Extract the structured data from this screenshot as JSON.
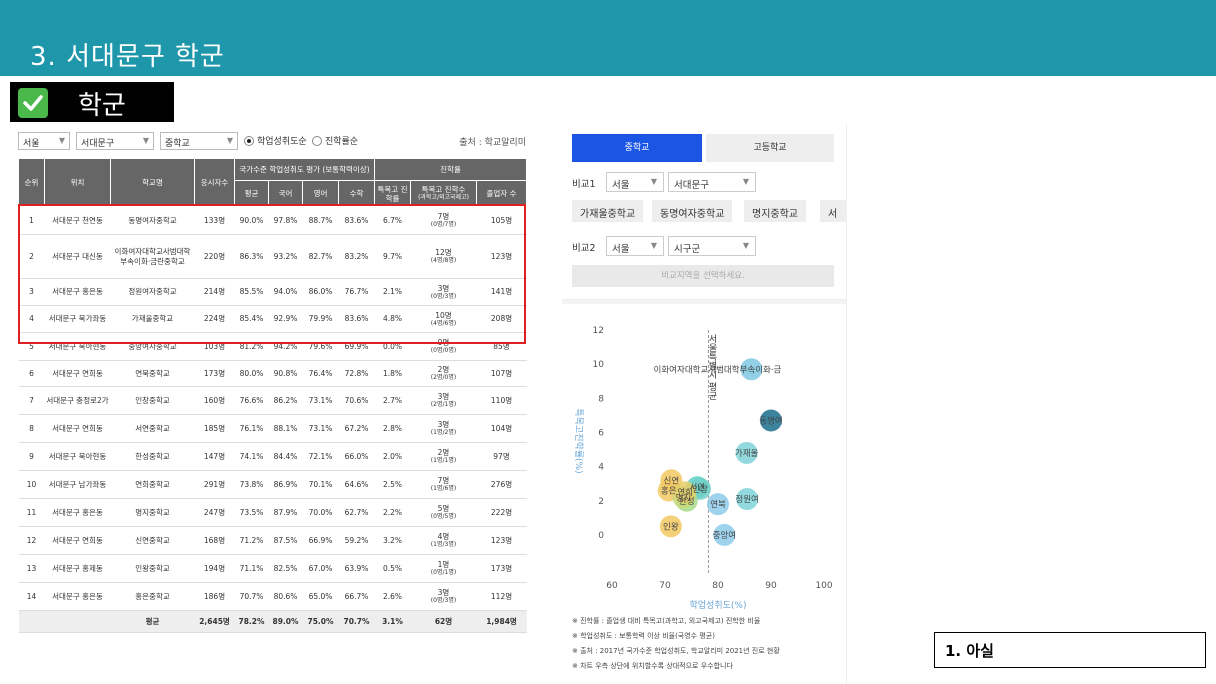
{
  "banner": {
    "title": "3. 서대문구 학군"
  },
  "section": {
    "label": "학군"
  },
  "filters": {
    "city": "서울",
    "district": "서대문구",
    "level": "중학교",
    "radio1": "학업성취도순",
    "radio2": "진학률순",
    "source": "출처 : 학교알리미"
  },
  "table": {
    "headers": {
      "rank": "순위",
      "location": "위치",
      "school": "학교명",
      "applicants": "응시자수",
      "achievement_group": "국가수준 학업성취도 평가 (보통학력이상)",
      "avg": "평균",
      "korean": "국어",
      "english": "영어",
      "math": "수학",
      "advance_group": "진학률",
      "special_rate": "특목고 진학률",
      "special_count": "특목고 진학수",
      "special_count_sub": "(과학고/외고국제고)",
      "graduates": "졸업자 수"
    },
    "rows": [
      {
        "rank": "1",
        "loc": "서대문구 천연동",
        "name": "동명여자중학교",
        "n": "133명",
        "avg": "90.0%",
        "kor": "97.8%",
        "eng": "88.7%",
        "math": "83.6%",
        "rate": "6.7%",
        "cnt": "7명",
        "cnt_sub": "(0명/7명)",
        "grad": "105명"
      },
      {
        "rank": "2",
        "loc": "서대문구 대신동",
        "name": "이화여자대학교사범대학부속이화·금란중학교",
        "n": "220명",
        "avg": "86.3%",
        "kor": "93.2%",
        "eng": "82.7%",
        "math": "83.2%",
        "rate": "9.7%",
        "cnt": "12명",
        "cnt_sub": "(4명/8명)",
        "grad": "123명"
      },
      {
        "rank": "3",
        "loc": "서대문구 홍은동",
        "name": "정원여자중학교",
        "n": "214명",
        "avg": "85.5%",
        "kor": "94.0%",
        "eng": "86.0%",
        "math": "76.7%",
        "rate": "2.1%",
        "cnt": "3명",
        "cnt_sub": "(0명/3명)",
        "grad": "141명"
      },
      {
        "rank": "4",
        "loc": "서대문구 북가좌동",
        "name": "가재울중학교",
        "n": "224명",
        "avg": "85.4%",
        "kor": "92.9%",
        "eng": "79.9%",
        "math": "83.6%",
        "rate": "4.8%",
        "cnt": "10명",
        "cnt_sub": "(4명/6명)",
        "grad": "208명"
      },
      {
        "rank": "5",
        "loc": "서대문구 북아현동",
        "name": "중앙여자중학교",
        "n": "103명",
        "avg": "81.2%",
        "kor": "94.2%",
        "eng": "79.6%",
        "math": "69.9%",
        "rate": "0.0%",
        "cnt": "0명",
        "cnt_sub": "(0명/0명)",
        "grad": "85명"
      },
      {
        "rank": "6",
        "loc": "서대문구 연희동",
        "name": "연북중학교",
        "n": "173명",
        "avg": "80.0%",
        "kor": "90.8%",
        "eng": "76.4%",
        "math": "72.8%",
        "rate": "1.8%",
        "cnt": "2명",
        "cnt_sub": "(2명/0명)",
        "grad": "107명"
      },
      {
        "rank": "7",
        "loc": "서대문구 충정로2가",
        "name": "인창중학교",
        "n": "160명",
        "avg": "76.6%",
        "kor": "86.2%",
        "eng": "73.1%",
        "math": "70.6%",
        "rate": "2.7%",
        "cnt": "3명",
        "cnt_sub": "(2명/1명)",
        "grad": "110명"
      },
      {
        "rank": "8",
        "loc": "서대문구 연희동",
        "name": "서연중학교",
        "n": "185명",
        "avg": "76.1%",
        "kor": "88.1%",
        "eng": "73.1%",
        "math": "67.2%",
        "rate": "2.8%",
        "cnt": "3명",
        "cnt_sub": "(1명/2명)",
        "grad": "104명"
      },
      {
        "rank": "9",
        "loc": "서대문구 북아현동",
        "name": "한성중학교",
        "n": "147명",
        "avg": "74.1%",
        "kor": "84.4%",
        "eng": "72.1%",
        "math": "66.0%",
        "rate": "2.0%",
        "cnt": "2명",
        "cnt_sub": "(1명/1명)",
        "grad": "97명"
      },
      {
        "rank": "10",
        "loc": "서대문구 남가좌동",
        "name": "연희중학교",
        "n": "291명",
        "avg": "73.8%",
        "kor": "86.9%",
        "eng": "70.1%",
        "math": "64.6%",
        "rate": "2.5%",
        "cnt": "7명",
        "cnt_sub": "(1명/6명)",
        "grad": "276명"
      },
      {
        "rank": "11",
        "loc": "서대문구 홍은동",
        "name": "명지중학교",
        "n": "247명",
        "avg": "73.5%",
        "kor": "87.9%",
        "eng": "70.0%",
        "math": "62.7%",
        "rate": "2.2%",
        "cnt": "5명",
        "cnt_sub": "(0명/5명)",
        "grad": "222명"
      },
      {
        "rank": "12",
        "loc": "서대문구 연희동",
        "name": "신연중학교",
        "n": "168명",
        "avg": "71.2%",
        "kor": "87.5%",
        "eng": "66.9%",
        "math": "59.2%",
        "rate": "3.2%",
        "cnt": "4명",
        "cnt_sub": "(1명/3명)",
        "grad": "123명"
      },
      {
        "rank": "13",
        "loc": "서대문구 홍제동",
        "name": "인왕중학교",
        "n": "194명",
        "avg": "71.1%",
        "kor": "82.5%",
        "eng": "67.0%",
        "math": "63.9%",
        "rate": "0.5%",
        "cnt": "1명",
        "cnt_sub": "(0명/1명)",
        "grad": "173명"
      },
      {
        "rank": "14",
        "loc": "서대문구 홍은동",
        "name": "홍은중학교",
        "n": "186명",
        "avg": "70.7%",
        "kor": "80.6%",
        "eng": "65.0%",
        "math": "66.7%",
        "rate": "2.6%",
        "cnt": "3명",
        "cnt_sub": "(0명/3명)",
        "grad": "112명"
      }
    ],
    "footer": {
      "label": "평균",
      "n": "2,645명",
      "avg": "78.2%",
      "kor": "89.0%",
      "eng": "75.0%",
      "math": "70.7%",
      "rate": "3.1%",
      "cnt": "62명",
      "grad": "1,984명"
    }
  },
  "right": {
    "tab_middle": "중학교",
    "tab_high": "고등학교",
    "compare1_label": "비교1",
    "compare1_city": "서울",
    "compare1_district": "서대문구",
    "chips": [
      "가재울중학교",
      "동명여자중학교",
      "명지중학교",
      "서"
    ],
    "compare2_label": "비교2",
    "compare2_city": "서울",
    "compare2_district": "시구군",
    "prompt": "비교지역을 선택하세요."
  },
  "chart_data": {
    "type": "scatter",
    "xlabel": "학업성취도(%)",
    "ylabel": "특목고진학률(%)",
    "xlim": [
      60,
      100
    ],
    "ylim": [
      -1,
      12
    ],
    "xticks": [
      "60",
      "70",
      "80",
      "90",
      "100"
    ],
    "yticks": [
      "0",
      "2",
      "4",
      "6",
      "8",
      "10",
      "12"
    ],
    "reference_x": 78.2,
    "reference_label": "서울특별시 평균",
    "points": [
      {
        "label": "이화여자대학교사범대학부속이화·금",
        "x": 86.3,
        "y": 9.7,
        "color": "#7ec8e3"
      },
      {
        "label": "동명여",
        "x": 90.0,
        "y": 6.7,
        "color": "#1a6f8c"
      },
      {
        "label": "가재울",
        "x": 85.4,
        "y": 4.8,
        "color": "#7fd3d8"
      },
      {
        "label": "정원여",
        "x": 85.5,
        "y": 2.1,
        "color": "#7fd3d8"
      },
      {
        "label": "중앙여",
        "x": 81.2,
        "y": 0.0,
        "color": "#8ecbea"
      },
      {
        "label": "연북",
        "x": 80.0,
        "y": 1.8,
        "color": "#8ecbea"
      },
      {
        "label": "신연",
        "x": 71.2,
        "y": 3.2,
        "color": "#f2c862"
      },
      {
        "label": "서연",
        "x": 76.1,
        "y": 2.8,
        "color": "#5fcfc5"
      },
      {
        "label": "인창",
        "x": 76.6,
        "y": 2.7,
        "color": "#6fd0c8"
      },
      {
        "label": "한성",
        "x": 74.1,
        "y": 2.0,
        "color": "#a6d98a"
      },
      {
        "label": "홍은",
        "x": 70.7,
        "y": 2.6,
        "color": "#f2c862"
      },
      {
        "label": "명지",
        "x": 73.5,
        "y": 2.2,
        "color": "#c9d97a"
      },
      {
        "label": "연희",
        "x": 73.8,
        "y": 2.5,
        "color": "#e6cf6a"
      },
      {
        "label": "인왕",
        "x": 71.1,
        "y": 0.5,
        "color": "#f2c862"
      }
    ]
  },
  "notes": [
    "※ 진학률 : 졸업생 대비 특목고(과학고, 외고국제고) 진학한 비율",
    "※ 학업성취도 : 보통학력 이상 비율(국영수 평균)",
    "※ 출처 : 2017년 국가수준 학업성취도, 학교알리미 2021년 진로 현황",
    "※ 차트 우측 상단에 위치할수록 상대적으로 우수합니다"
  ],
  "caption": "1. 아실"
}
